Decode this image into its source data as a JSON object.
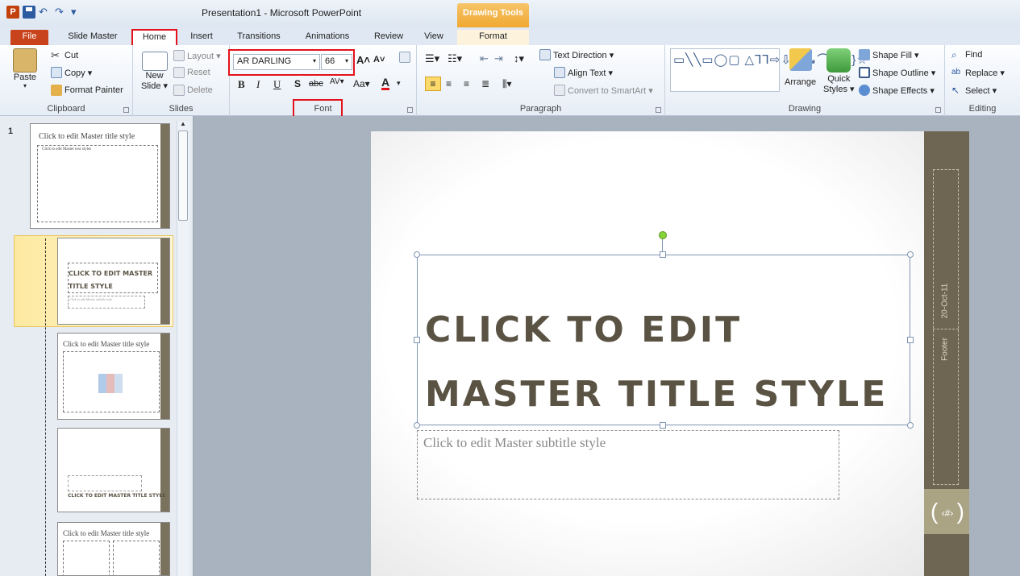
{
  "window": {
    "title": "Presentation1 - Microsoft PowerPoint",
    "context_tab": "Drawing Tools"
  },
  "tabs": [
    "File",
    "Slide Master",
    "Home",
    "Insert",
    "Transitions",
    "Animations",
    "Review",
    "View",
    "Format"
  ],
  "ribbon": {
    "clipboard": {
      "label": "Clipboard",
      "paste": "Paste",
      "cut": "Cut",
      "copy": "Copy ▾",
      "format_painter": "Format Painter"
    },
    "slides": {
      "label": "Slides",
      "new_slide": "New",
      "new_slide2": "Slide ▾",
      "layout": "Layout ▾",
      "reset": "Reset",
      "delete": "Delete"
    },
    "font": {
      "label": "Font",
      "font_name": "AR DARLING",
      "font_size": "66"
    },
    "paragraph": {
      "label": "Paragraph",
      "text_direction": "Text Direction ▾",
      "align_text": "Align Text ▾",
      "convert_smartart": "Convert to SmartArt ▾"
    },
    "drawing": {
      "label": "Drawing",
      "arrange": "Arrange",
      "quick_styles": "Quick",
      "quick_styles2": "Styles ▾",
      "shape_fill": "Shape Fill ▾",
      "shape_outline": "Shape Outline ▾",
      "shape_effects": "Shape Effects ▾"
    },
    "editing": {
      "label": "Editing",
      "find": "Find",
      "replace": "Replace ▾",
      "select": "Select ▾"
    }
  },
  "thumbnails": {
    "number": "1",
    "t1_title": "Click to edit Master title style",
    "t1_body": "Click to edit Master text styles",
    "t2_title": "CLICK TO EDIT MASTER TITLE STYLE",
    "t2_sub": "Click to edit Master subtitle style",
    "t3_title": "Click to edit Master title style",
    "t4_title": "CLICK TO EDIT MASTER TITLE STYLE",
    "t5_title": "Click to edit Master title style"
  },
  "slide": {
    "title": "Click to edit Master title style",
    "subtitle": "Click to edit Master subtitle style",
    "date": "20-Oct-11",
    "footer": "Footer",
    "slide_number": "‹#›"
  },
  "colors": {
    "accent_bar": "#6e6652",
    "accent_bar_light": "#aaa384",
    "highlight_box": "#e3121b",
    "title_text": "#5a5344"
  }
}
